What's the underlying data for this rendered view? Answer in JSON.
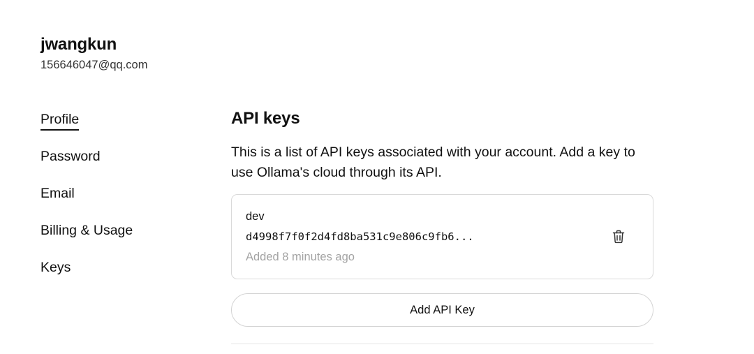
{
  "user": {
    "name": "jwangkun",
    "email": "156646047@qq.com"
  },
  "nav": {
    "items": [
      {
        "label": "Profile",
        "active": true
      },
      {
        "label": "Password",
        "active": false
      },
      {
        "label": "Email",
        "active": false
      },
      {
        "label": "Billing & Usage",
        "active": false
      },
      {
        "label": "Keys",
        "active": false
      }
    ]
  },
  "api_keys": {
    "title": "API keys",
    "description": "This is a list of API keys associated with your account. Add a key to use Ollama's cloud through its API.",
    "keys": [
      {
        "name": "dev",
        "value": "d4998f7f0f2d4fd8ba531c9e806c9fb6...",
        "added": "Added 8 minutes ago",
        "delete_icon": "trash-icon"
      }
    ],
    "add_button_label": "Add API Key"
  }
}
